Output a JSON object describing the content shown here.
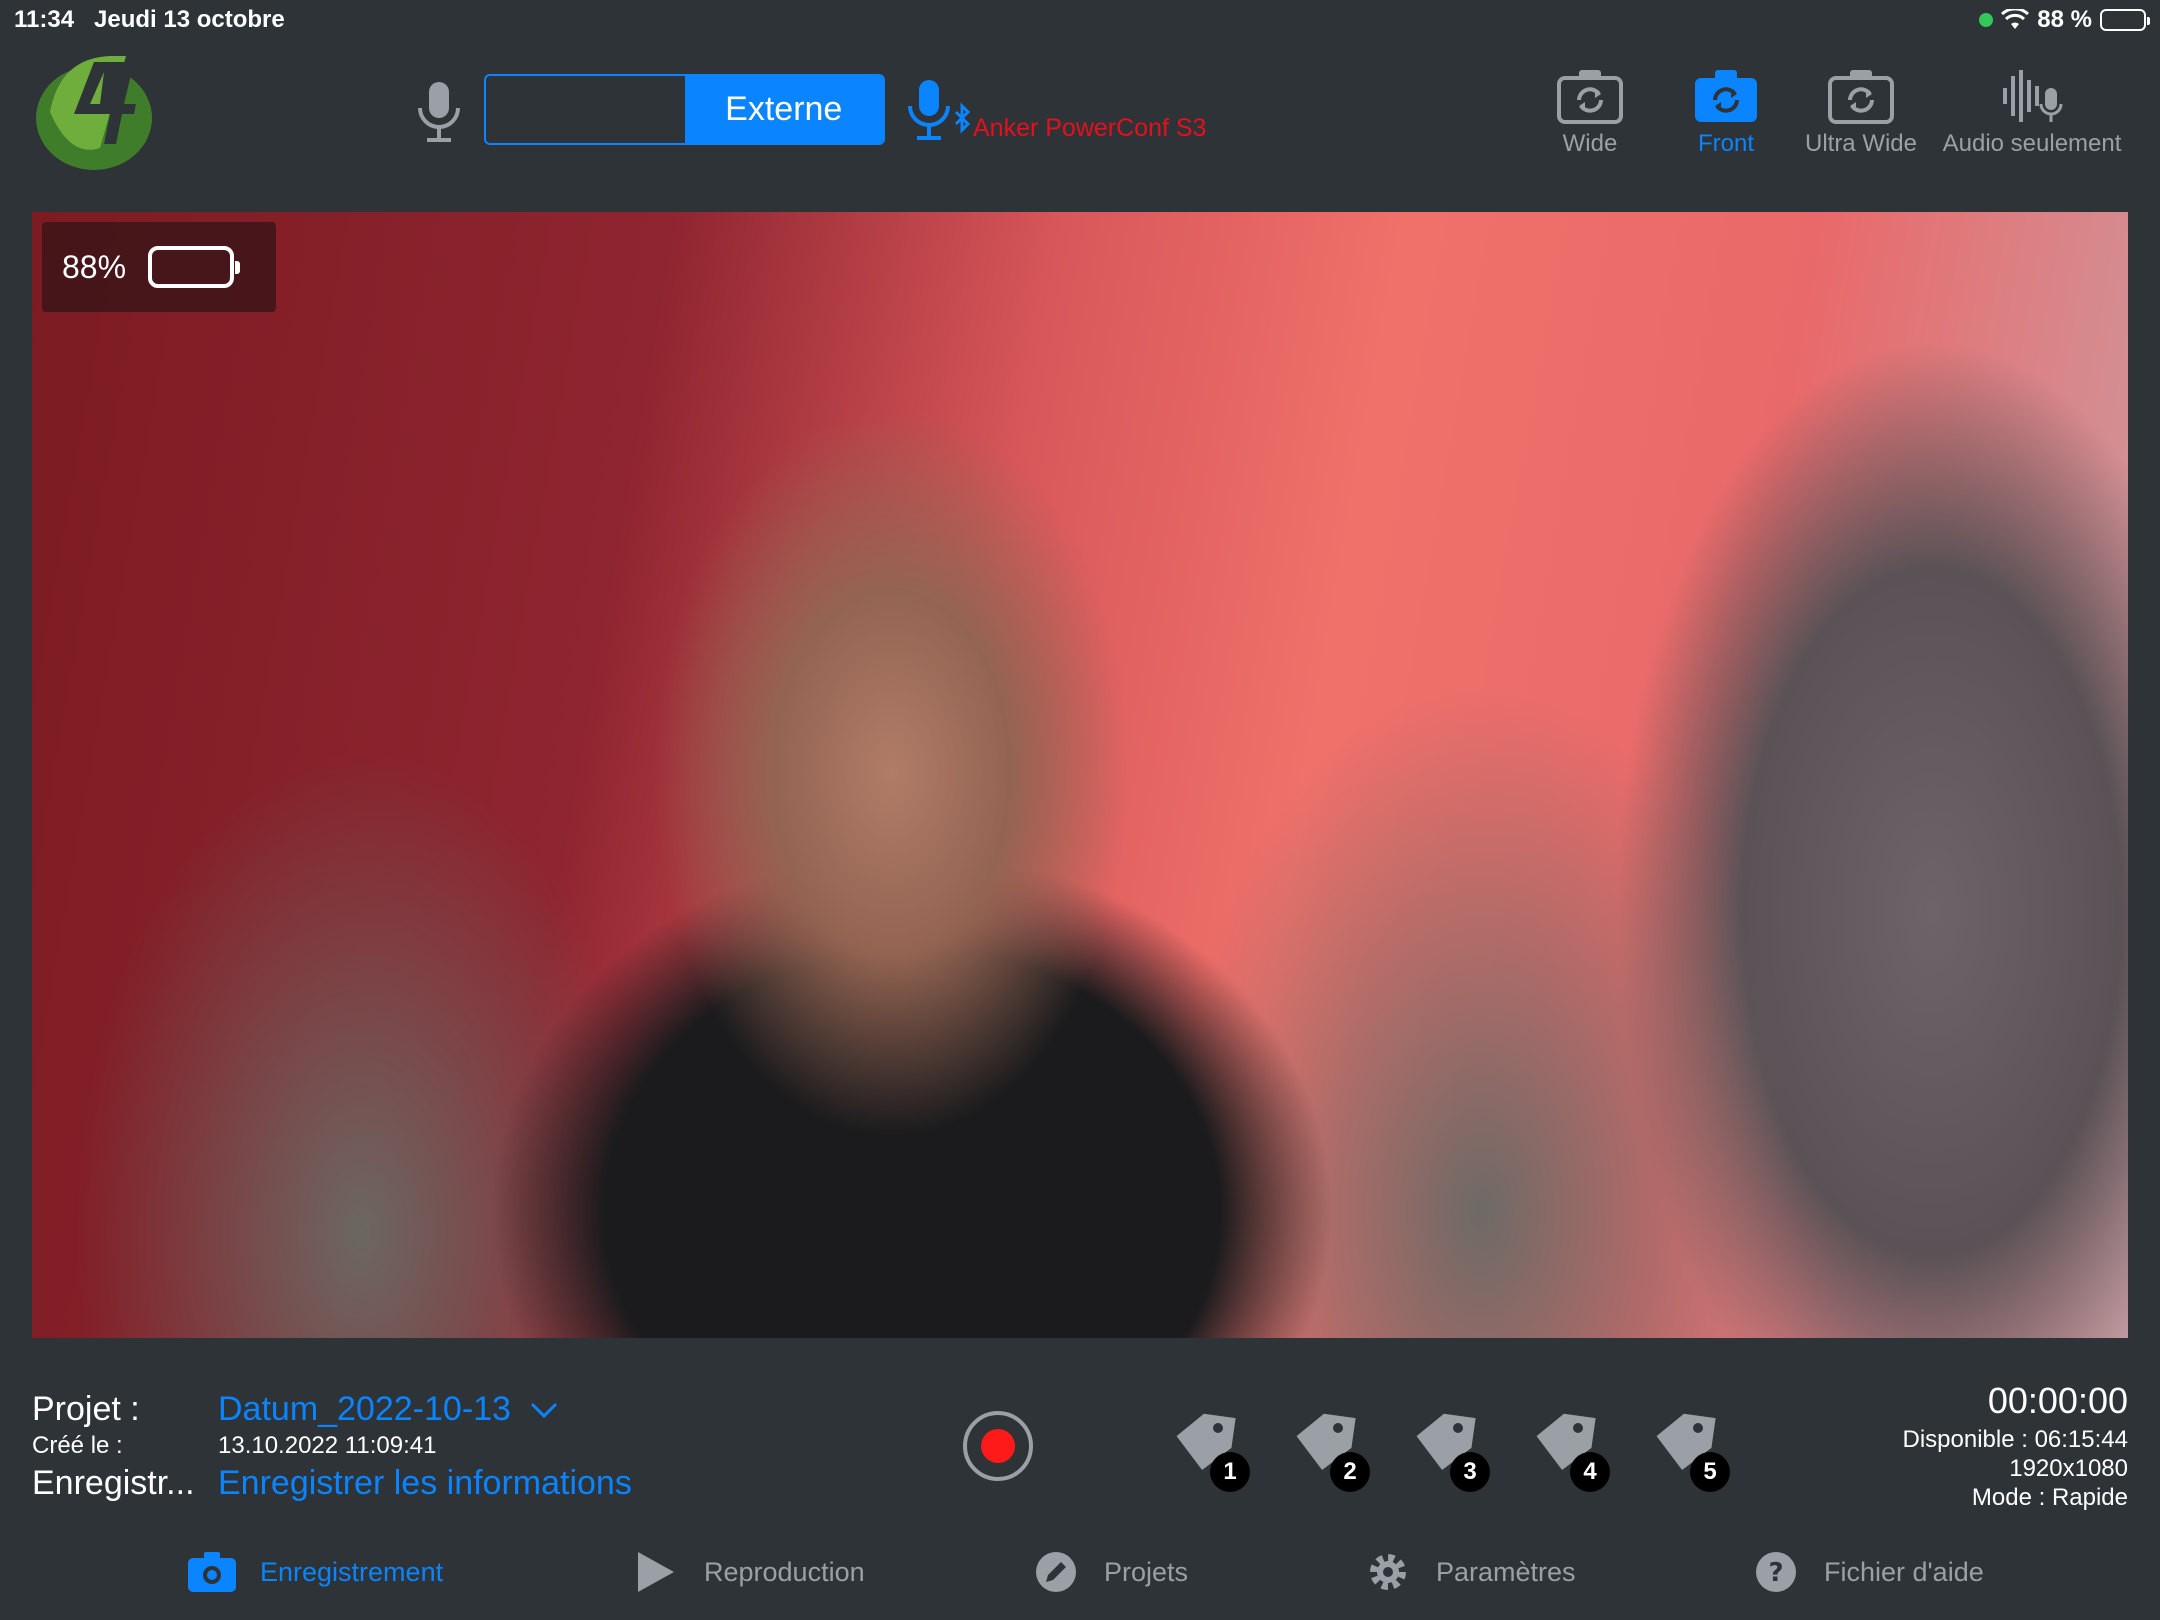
{
  "status_bar": {
    "time": "11:34",
    "date": "Jeudi 13 octobre",
    "battery_text": "88 %",
    "battery_level": 0.88
  },
  "toolbar": {
    "audio_source": {
      "options": [
        "",
        "Externe"
      ],
      "selected": "Externe"
    },
    "external_device_name": "Anker PowerConf S3",
    "cameras": [
      {
        "label": "Wide",
        "active": false,
        "icon": "camera-rotate-icon"
      },
      {
        "label": "Front",
        "active": true,
        "icon": "camera-rotate-icon"
      },
      {
        "label": "Ultra Wide",
        "active": false,
        "icon": "camera-rotate-icon"
      },
      {
        "label": "Audio seulement",
        "active": false,
        "icon": "audio-waveform-mic-icon"
      }
    ]
  },
  "preview": {
    "battery_percent_text": "88%",
    "battery_level": 0.88
  },
  "project": {
    "project_label": "Projet :",
    "project_value": "Datum_2022-10-13",
    "created_label": "Créé le :",
    "created_value": "13.10.2022 11:09:41",
    "record_label": "Enregistr...",
    "record_value": "Enregistrer les informations"
  },
  "tags": [
    "1",
    "2",
    "3",
    "4",
    "5"
  ],
  "recording_info": {
    "timer": "00:00:00",
    "available": "Disponible : 06:15:44",
    "resolution": "1920x1080",
    "mode": "Mode : Rapide"
  },
  "tabs": [
    {
      "label": "Enregistrement",
      "icon": "camera-icon",
      "active": true
    },
    {
      "label": "Reproduction",
      "icon": "play-icon",
      "active": false
    },
    {
      "label": "Projets",
      "icon": "pencil-icon",
      "active": false
    },
    {
      "label": "Paramètres",
      "icon": "gear-icon",
      "active": false
    },
    {
      "label": "Fichier d'aide",
      "icon": "help-icon",
      "active": false
    }
  ],
  "colors": {
    "background": "#2e3337",
    "accent": "#0a84ff",
    "inactive": "#9aa0a6",
    "device_name": "#e5101d",
    "record": "#ff1a1a",
    "battery_fill": "#30d158"
  }
}
